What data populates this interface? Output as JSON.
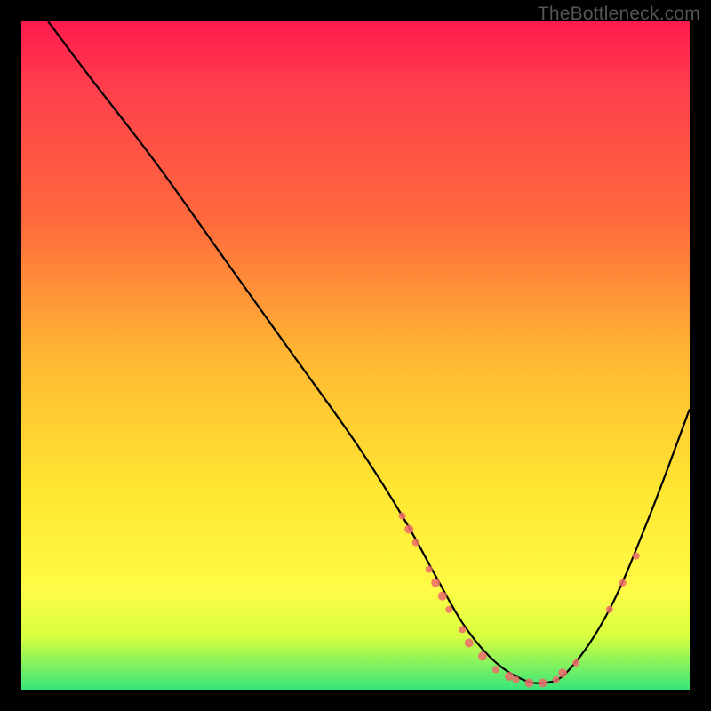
{
  "watermark": "TheBottleneck.com",
  "colors": {
    "background": "#000000",
    "gradient_top": "#ff1a4d",
    "gradient_mid1": "#ff6a3c",
    "gradient_mid2": "#ffe631",
    "gradient_bottom": "#36e67a",
    "curve": "#000000",
    "marker_fill": "#ef6b6b",
    "marker_stroke": "#c44"
  },
  "chart_data": {
    "type": "line",
    "title": "",
    "xlabel": "",
    "ylabel": "",
    "xlim": [
      0,
      100
    ],
    "ylim": [
      0,
      100
    ],
    "curve": {
      "x": [
        4,
        10,
        20,
        30,
        40,
        50,
        57,
        62,
        66,
        70,
        74,
        78,
        82,
        88,
        94,
        100
      ],
      "y": [
        100,
        92,
        79,
        65,
        51,
        37,
        26,
        17,
        10,
        5,
        2,
        1,
        3,
        12,
        26,
        42
      ]
    },
    "markers": [
      {
        "x": 57,
        "y": 26,
        "r": 4
      },
      {
        "x": 58,
        "y": 24,
        "r": 5
      },
      {
        "x": 59,
        "y": 22,
        "r": 4
      },
      {
        "x": 61,
        "y": 18,
        "r": 4
      },
      {
        "x": 62,
        "y": 16,
        "r": 5
      },
      {
        "x": 63,
        "y": 14,
        "r": 5
      },
      {
        "x": 64,
        "y": 12,
        "r": 4
      },
      {
        "x": 66,
        "y": 9,
        "r": 4
      },
      {
        "x": 67,
        "y": 7,
        "r": 5
      },
      {
        "x": 69,
        "y": 5,
        "r": 5
      },
      {
        "x": 71,
        "y": 3,
        "r": 4
      },
      {
        "x": 73,
        "y": 2,
        "r": 5
      },
      {
        "x": 74,
        "y": 1.5,
        "r": 4
      },
      {
        "x": 76,
        "y": 1,
        "r": 5
      },
      {
        "x": 78,
        "y": 1,
        "r": 5
      },
      {
        "x": 80,
        "y": 1.5,
        "r": 4
      },
      {
        "x": 81,
        "y": 2.5,
        "r": 5
      },
      {
        "x": 83,
        "y": 4,
        "r": 4
      },
      {
        "x": 88,
        "y": 12,
        "r": 4
      },
      {
        "x": 90,
        "y": 16,
        "r": 4
      },
      {
        "x": 92,
        "y": 20,
        "r": 4
      }
    ]
  }
}
